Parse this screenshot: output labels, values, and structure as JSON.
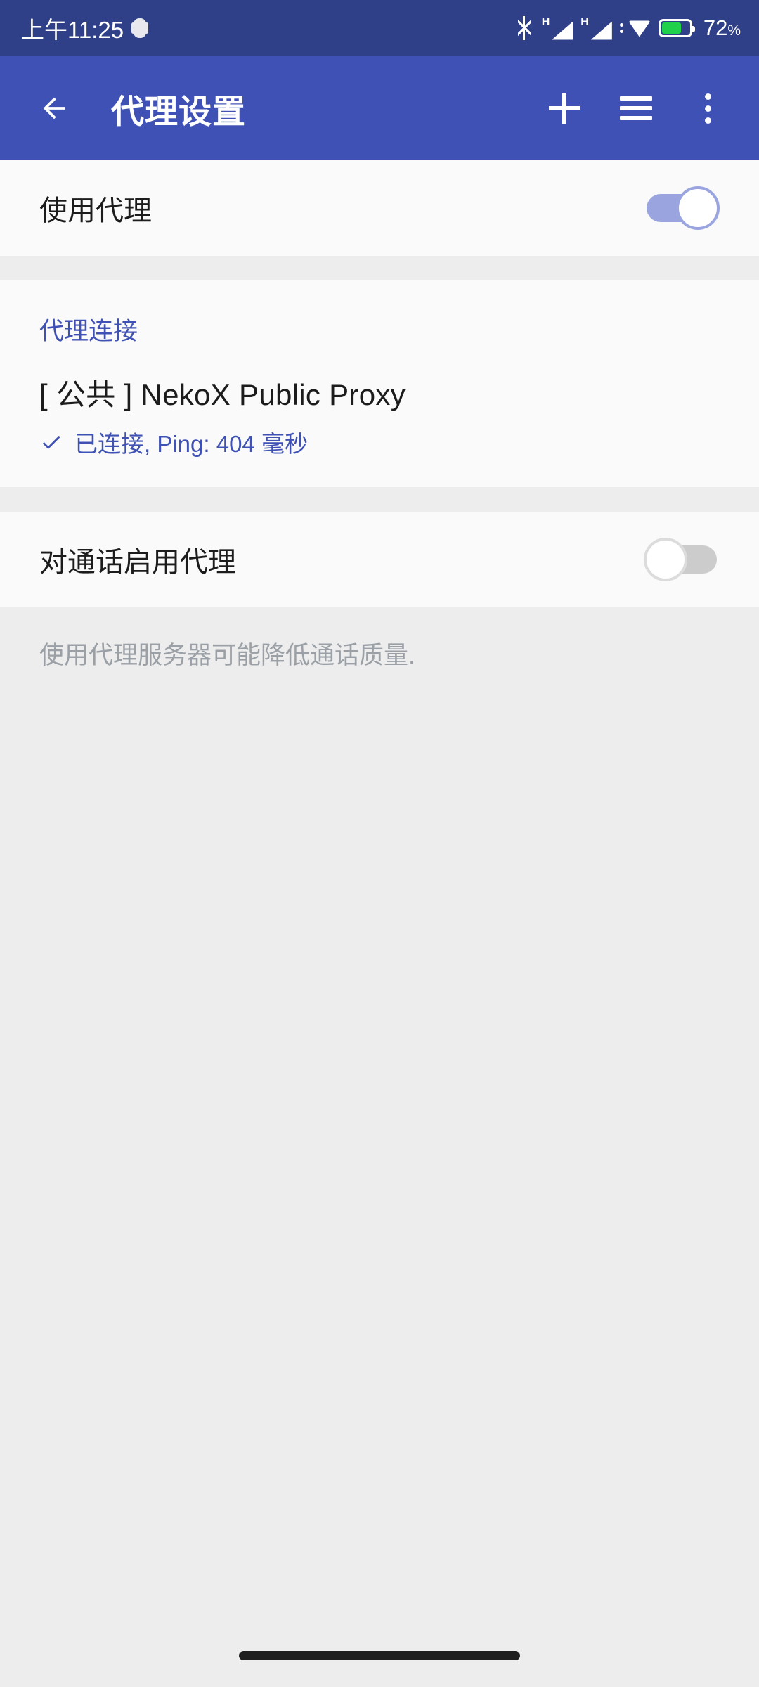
{
  "status_bar": {
    "time": "上午11:25",
    "battery_percent": "72",
    "battery_percent_symbol": "%",
    "icons": [
      "notification-icon",
      "bluetooth-icon",
      "signal-h-1-icon",
      "signal-h-2-icon",
      "wifi-icon",
      "battery-charging-icon"
    ],
    "network_type_1": "H",
    "network_type_2": "H",
    "background_color": "#2f4088"
  },
  "app_bar": {
    "title": "代理设置",
    "back_icon": "arrow-back-icon",
    "actions": [
      {
        "name": "add-proxy-button",
        "icon": "plus-icon"
      },
      {
        "name": "menu-button",
        "icon": "hamburger-menu-icon"
      },
      {
        "name": "overflow-menu-button",
        "icon": "kebab-menu-icon"
      }
    ],
    "background_color": "#3f51b5"
  },
  "sections": {
    "use_proxy": {
      "label": "使用代理",
      "toggle_state": "on",
      "toggle_color": "#9aa4de"
    },
    "proxy_connection": {
      "header": "代理连接",
      "header_color": "#3f51b5",
      "proxy_name": "[ 公共 ] NekoX Public Proxy",
      "status_icon": "check-icon",
      "status_text": "已连接, Ping: 404 毫秒",
      "status_color": "#3f51b5",
      "ping_ms": "404"
    },
    "calls_proxy": {
      "label": "对通话启用代理",
      "toggle_state": "off",
      "toggle_color": "#cccccc"
    },
    "footer_note": {
      "text": "使用代理服务器可能降低通话质量."
    }
  },
  "navigation_bar": {
    "gesture_pill": "home-gesture-pill"
  }
}
